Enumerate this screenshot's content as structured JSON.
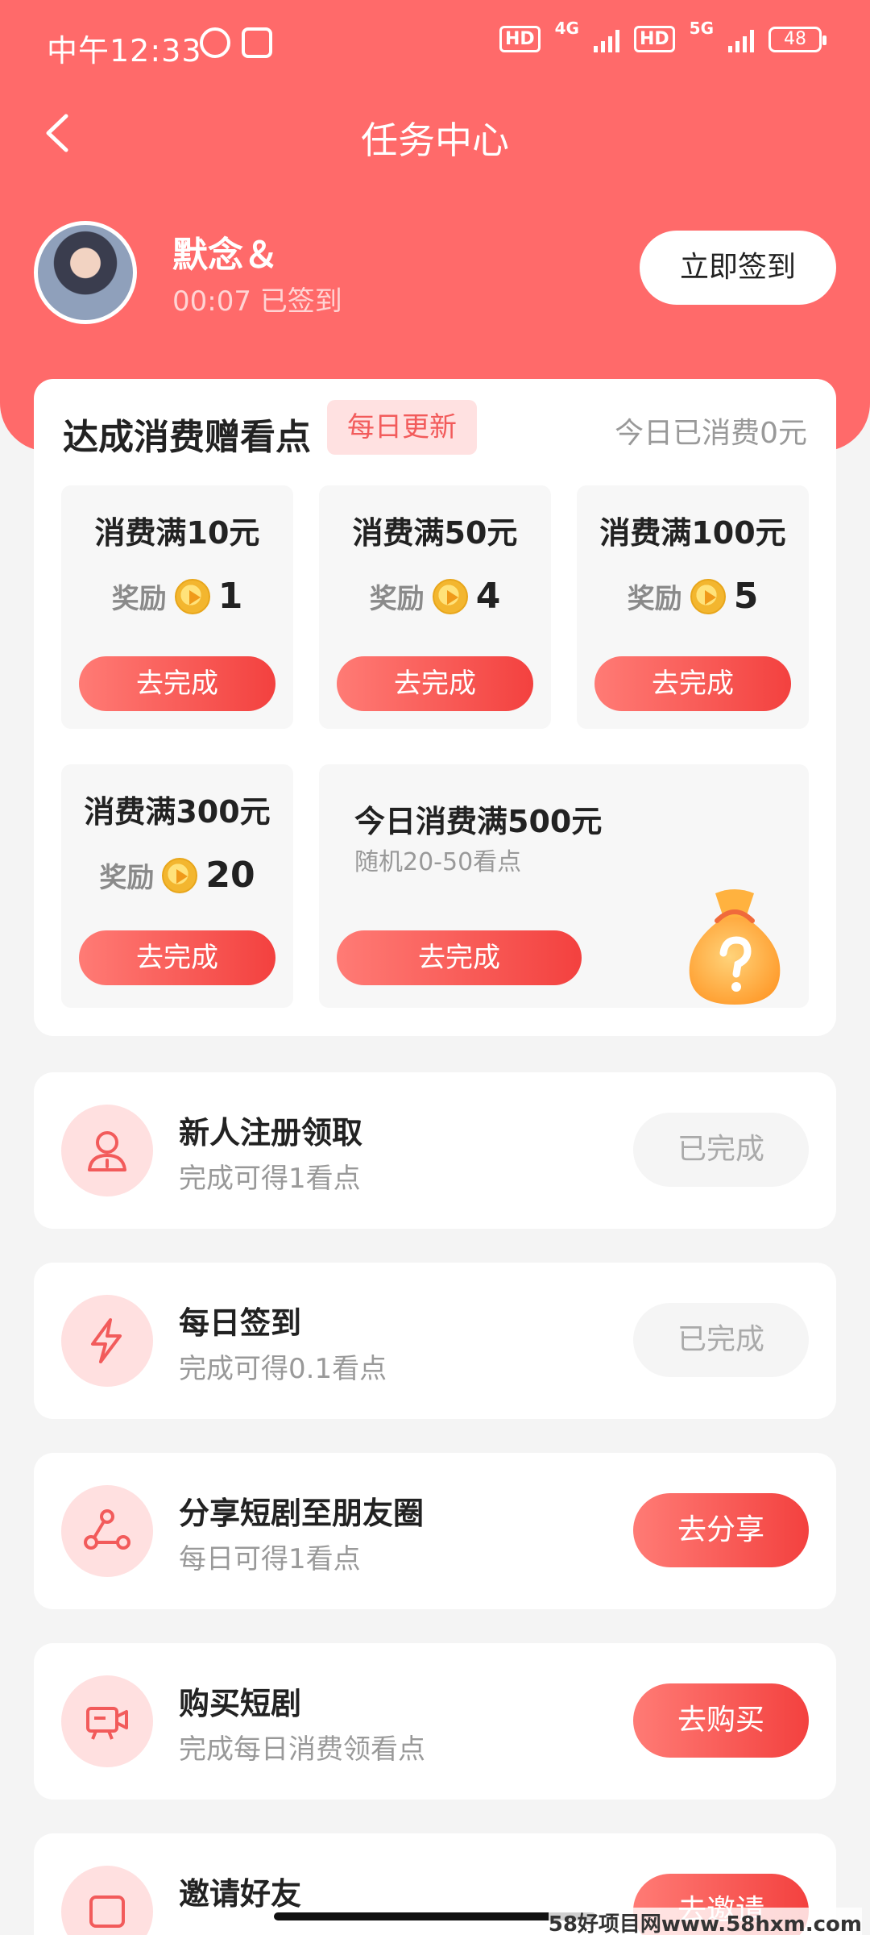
{
  "status_bar": {
    "time": "中午12:33",
    "hd1": "HD",
    "net1": "4G",
    "hd2": "HD",
    "net2": "5G",
    "battery": "48"
  },
  "header": {
    "title": "任务中心"
  },
  "profile": {
    "username": "默念＆",
    "sign_status": "00:07 已签到",
    "sign_button": "立即签到"
  },
  "consume": {
    "title": "达成消费赠看点",
    "badge": "每日更新",
    "today_spent": "今日已消费0元",
    "reward_label": "奖励",
    "tiles": [
      {
        "title": "消费满10元",
        "reward": "1",
        "button": "去完成"
      },
      {
        "title": "消费满50元",
        "reward": "4",
        "button": "去完成"
      },
      {
        "title": "消费满100元",
        "reward": "5",
        "button": "去完成"
      },
      {
        "title": "消费满300元",
        "reward": "20",
        "button": "去完成"
      }
    ],
    "big_tile": {
      "title": "今日消费满500元",
      "subtitle": "随机20-50看点",
      "button": "去完成"
    }
  },
  "tasks": [
    {
      "title": "新人注册领取",
      "subtitle": "完成可得1看点",
      "button": "已完成",
      "icon": "user-icon"
    },
    {
      "title": "每日签到",
      "subtitle": "完成可得0.1看点",
      "button": "已完成",
      "icon": "lightning-icon"
    },
    {
      "title": "分享短剧至朋友圈",
      "subtitle": "每日可得1看点",
      "button": "去分享",
      "icon": "share-icon"
    },
    {
      "title": "购买短剧",
      "subtitle": "完成每日消费领看点",
      "button": "去购买",
      "icon": "video-camera-icon"
    },
    {
      "title": "邀请好友",
      "subtitle": "",
      "button": "去邀请",
      "icon": "invite-icon"
    }
  ],
  "watermark": "58好项目网www.58hxm.com",
  "colors": {
    "primary": "#ff6a6a",
    "button_gradient_start": "#ff7b75",
    "button_gradient_end": "#f3413f",
    "badge_bg": "#ffe1e1"
  }
}
